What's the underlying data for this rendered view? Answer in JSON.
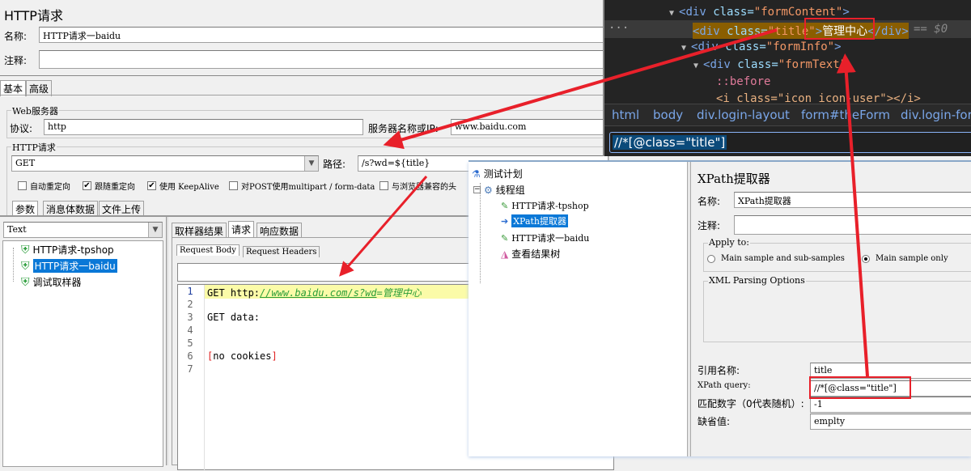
{
  "http_request": {
    "title": "HTTP请求",
    "name_label": "名称:",
    "name_value": "HTTP请求一baidu",
    "comment_label": "注释:",
    "comment_value": "",
    "tabs": [
      "基本",
      "高级"
    ],
    "web_server": {
      "group_title": "Web服务器",
      "protocol_label": "协议:",
      "protocol_value": "http",
      "server_label": "服务器名称或IP:",
      "server_value": "www.baidu.com"
    },
    "http": {
      "group_title": "HTTP请求",
      "method": "GET",
      "path_label": "路径:",
      "path_value": "/s?wd=${title}"
    },
    "checkboxes": [
      {
        "label": "自动重定向",
        "checked": false
      },
      {
        "label": "跟随重定向",
        "checked": true
      },
      {
        "label": "使用 KeepAlive",
        "checked": true
      },
      {
        "label": "对POST使用multipart / form-data",
        "checked": false
      },
      {
        "label": "与浏览器兼容的头",
        "checked": false
      }
    ],
    "param_tabs": [
      "参数",
      "消息体数据",
      "文件上传"
    ]
  },
  "results_tree": {
    "renderer": "Text",
    "items": [
      {
        "label": "HTTP请求-tpshop",
        "selected": false
      },
      {
        "label": "HTTP请求一baidu",
        "selected": true
      },
      {
        "label": "调试取样器",
        "selected": false
      }
    ],
    "tabs": [
      "取样器结果",
      "请求",
      "响应数据"
    ],
    "sub_tabs": [
      "Request Body",
      "Request Headers"
    ],
    "lines": {
      "l1_method": "GET http:",
      "l1_url": "//www.baidu.com/s?wd",
      "l1_value": "=管理中心",
      "l3": "GET data:",
      "l6": "no cookies"
    },
    "line_numbers": [
      "1",
      "2",
      "3",
      "4",
      "5",
      "6",
      "7"
    ]
  },
  "devtools": {
    "lines": {
      "formContent_tag": "<div ",
      "formContent_attr": "class=",
      "formContent_val": "\"formContent\"",
      "formContent_end": ">",
      "title_tag": "<div ",
      "title_attr": "class=",
      "title_val": "\"title\"",
      "title_text": "管理中心",
      "title_close": "</div>",
      "title_ref": "== $0",
      "formInfo_tag": "<div ",
      "formInfo_attr": "class=",
      "formInfo_val": "\"formInfo\"",
      "formInfo_end": ">",
      "formText_tag": "<div ",
      "formText_attr": "class=",
      "formText_val": "\"formText\"",
      "before": "::before",
      "icon_line": "<i class=\"icon icon-user\"></i>"
    },
    "breadcrumbs": [
      "html",
      "body",
      "div.login-layout",
      "form#theForm",
      "div.login-form"
    ],
    "search_value": "//*[@class=\"title\"]"
  },
  "plan_tree": {
    "items": [
      {
        "label": "测试计划",
        "icon": "flask-icon"
      },
      {
        "label": "线程组",
        "icon": "gear-icon"
      },
      {
        "label": "HTTP请求-tpshop",
        "icon": "pipette-icon"
      },
      {
        "label": "XPath提取器",
        "icon": "extractor-icon",
        "selected": true
      },
      {
        "label": "HTTP请求一baidu",
        "icon": "pipette-icon"
      },
      {
        "label": "查看结果树",
        "icon": "chart-icon"
      }
    ]
  },
  "xpath": {
    "title": "XPath提取器",
    "name_label": "名称:",
    "name_value": "XPath提取器",
    "comment_label": "注释:",
    "comment_value": "",
    "apply_to_title": "Apply to:",
    "apply_options": [
      {
        "label": "Main sample and sub-samples",
        "checked": false
      },
      {
        "label": "Main sample only",
        "checked": true
      }
    ],
    "xml_title": "XML Parsing Options",
    "ref_label": "引用名称:",
    "ref_value": "title",
    "query_label": "XPath query:",
    "query_value": "//*[@class=\"title\"]",
    "match_label": "匹配数字（0代表随机）:",
    "match_value": "-1",
    "default_label": "缺省值:",
    "default_value": "emplty"
  },
  "colors": {
    "annotation_red": "#e8202a",
    "selection_blue": "#0a78d7",
    "devtools_bg": "#242424"
  }
}
